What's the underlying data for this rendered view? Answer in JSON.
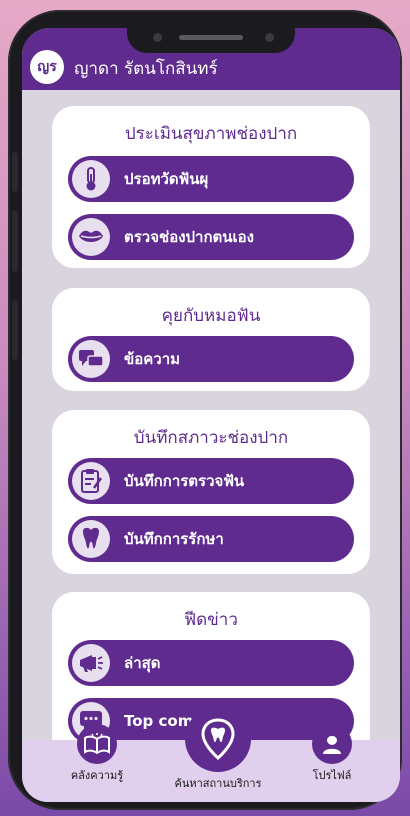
{
  "app": {
    "logo_text": "ญร",
    "user_name": "ญาดา รัตนโกสินทร์"
  },
  "sections": {
    "oral_assessment": {
      "title": "ประเมินสุขภาพช่องปาก",
      "items": [
        {
          "label": "ปรอทวัดฟันผุ",
          "icon": "thermometer-icon"
        },
        {
          "label": "ตรวจช่องปากตนเอง",
          "icon": "lips-icon"
        }
      ]
    },
    "chat_dentist": {
      "title": "คุยกับหมอฟัน",
      "items": [
        {
          "label": "ข้อความ",
          "icon": "chat-bubbles-icon"
        }
      ]
    },
    "oral_record": {
      "title": "บันทึกสภาวะช่องปาก",
      "items": [
        {
          "label": "บันทึกการตรวจฟัน",
          "icon": "clipboard-icon"
        },
        {
          "label": "บันทึกการรักษา",
          "icon": "tooth-icon"
        }
      ]
    },
    "news": {
      "title": "ฟีดข่าว",
      "items": [
        {
          "label": "ล่าสุด",
          "icon": "megaphone-icon"
        },
        {
          "label": "Top comm",
          "icon": "comment-icon"
        }
      ]
    }
  },
  "bottom_nav": {
    "knowledge": "คลังความรู้",
    "find_service": "ค้นหาสถานบริการ",
    "profile": "โปรไฟล์"
  },
  "colors": {
    "primary": "#5f2b8f",
    "background": "#d9d4dd",
    "nav_bg": "#e1cfee"
  }
}
